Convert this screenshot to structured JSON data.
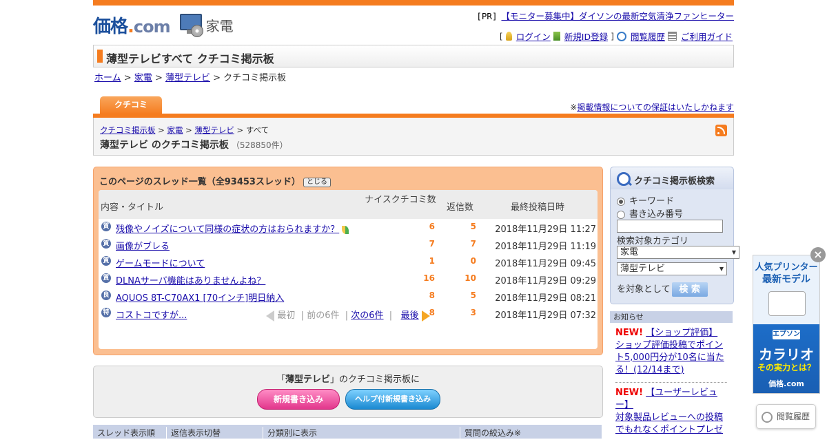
{
  "header": {
    "logo_main": "価格",
    "logo_dot": ".",
    "logo_com": "com",
    "category": "家電",
    "pr_tag": "[PR]",
    "pr_link": "【モニター募集中】ダイソンの最新空気清浄ファンヒーター",
    "nav": {
      "bracket_open": "[",
      "login": "ログイン",
      "register": "新規ID登録",
      "bracket_close": "]",
      "history": "閲覧履歴",
      "guide": "ご利用ガイド"
    }
  },
  "page_title": "薄型テレビすべて クチコミ掲示板",
  "breadcrumb": [
    "ホーム",
    "家電",
    "薄型テレビ",
    "クチコミ掲示板"
  ],
  "tab_label": "クチコミ",
  "notice": {
    "prefix": "※",
    "link": "掲載情報についての保証はいたしかねます"
  },
  "bbs": {
    "crumb": [
      "クチコミ掲示板",
      "家電",
      "薄型テレビ",
      "すべて"
    ],
    "heading": "薄型テレビ のクチコミ掲示板",
    "count": "（528850件）"
  },
  "threads": {
    "header": "このページのスレッド一覧（全93453スレッド）",
    "close_label": "とじる",
    "columns": {
      "title": "内容・タイトル",
      "nice": "ナイスクチコミ数",
      "replies": "返信数",
      "last": "最終投稿日時"
    },
    "rows": [
      {
        "badge": "質",
        "title": "残像やノイズについて同様の症状の方はおられますか？",
        "nice": "6",
        "replies": "5",
        "date": "2018年11月29日 11:27"
      },
      {
        "badge": "質",
        "title": "画像がブレる",
        "nice": "7",
        "replies": "7",
        "date": "2018年11月29日 11:19"
      },
      {
        "badge": "質",
        "title": "ゲームモードについて",
        "nice": "1",
        "replies": "0",
        "date": "2018年11月29日 09:45"
      },
      {
        "badge": "質",
        "title": "DLNAサーバ機能はありませんよね？",
        "nice": "16",
        "replies": "10",
        "date": "2018年11月29日 09:29"
      },
      {
        "badge": "良",
        "title": "AQUOS 8T-C70AX1 [70インチ]明日納入",
        "nice": "8",
        "replies": "5",
        "date": "2018年11月29日 08:21"
      },
      {
        "badge": "特",
        "title": "コストコですが...",
        "nice": "8",
        "replies": "3",
        "date": "2018年11月29日 07:32"
      }
    ],
    "pager": {
      "first": "最初",
      "prev": "前の6件",
      "next": "次の6件",
      "last": "最後"
    }
  },
  "post": {
    "text_pre": "「",
    "text_bold": "薄型テレビ",
    "text_post": "」のクチコミ掲示板に",
    "new_button": "新規書き込み",
    "help_button": "ヘルプ付新規書き込み"
  },
  "filterbar": [
    "スレッド表示順",
    "返信表示切替",
    "分類別に表示",
    "質問の絞込み※"
  ],
  "search": {
    "title": "クチコミ掲示板検索",
    "radio_keyword": "キーワード",
    "radio_number": "書き込み番号",
    "category_label": "検索対象カテゴリ",
    "select1": "家電",
    "select2": "薄型テレビ",
    "suffix": "を対象として",
    "button": "検 索"
  },
  "news": {
    "title": "お知らせ",
    "items": [
      {
        "new": "NEW!",
        "head": "【ショップ評価】",
        "body": "ショップ評価投稿でポイント5,000円分が10名に当たる！(12/14まで)"
      },
      {
        "new": "NEW!",
        "head": "【ユーザーレビュー】",
        "body": "対象製品レビューへの投稿でもれなくポイントプレゼ"
      }
    ]
  },
  "ad": {
    "line1": "人気プリンター",
    "line2": "最新モデル",
    "brand": "エプソン",
    "line3": "カラリオ",
    "line4": "その実力とは？",
    "line5": "価格.com",
    "close": "×"
  },
  "history_button": "閲覧履歴",
  "colors": {
    "accent": "#f57c1f",
    "link": "#1a0dab",
    "thread_bg": "#fbbf91"
  }
}
